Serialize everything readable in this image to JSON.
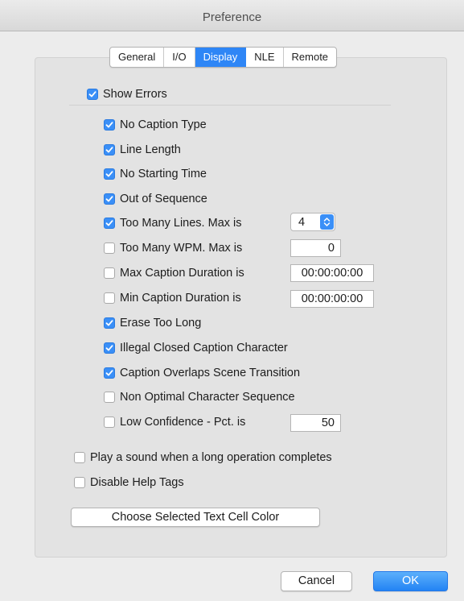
{
  "window": {
    "title": "Preference"
  },
  "tabs": [
    {
      "label": "General"
    },
    {
      "label": "I/O"
    },
    {
      "label": "Display"
    },
    {
      "label": "NLE"
    },
    {
      "label": "Remote"
    }
  ],
  "active_tab": "Display",
  "show_errors": {
    "label": "Show Errors",
    "checked": true
  },
  "errors": [
    {
      "label": "No Caption Type",
      "checked": true
    },
    {
      "label": "Line Length",
      "checked": true
    },
    {
      "label": "No Starting Time",
      "checked": true
    },
    {
      "label": "Out of Sequence",
      "checked": true
    },
    {
      "label": "Too Many Lines.  Max is",
      "checked": true,
      "stepper_value": "4"
    },
    {
      "label": "Too Many WPM.  Max is",
      "checked": false,
      "field_value": "0"
    },
    {
      "label": "Max Caption Duration is",
      "checked": false,
      "field_value": "00:00:00:00"
    },
    {
      "label": "Min Caption Duration is",
      "checked": false,
      "field_value": "00:00:00:00"
    },
    {
      "label": "Erase Too Long",
      "checked": true
    },
    {
      "label": "Illegal Closed Caption Character",
      "checked": true
    },
    {
      "label": "Caption Overlaps Scene Transition",
      "checked": true
    },
    {
      "label": "Non Optimal Character Sequence",
      "checked": false
    },
    {
      "label": "Low Confidence - Pct. is",
      "checked": false,
      "field_value": "50"
    }
  ],
  "options": [
    {
      "label": "Play a sound when a long operation completes",
      "checked": false
    },
    {
      "label": "Disable Help Tags",
      "checked": false
    }
  ],
  "choose_color_button": "Choose Selected Text Cell Color",
  "cancel_button": "Cancel",
  "ok_button": "OK",
  "colors": {
    "accent": "#2e86f6",
    "background": "#ececec",
    "panel": "#e3e3e3"
  }
}
